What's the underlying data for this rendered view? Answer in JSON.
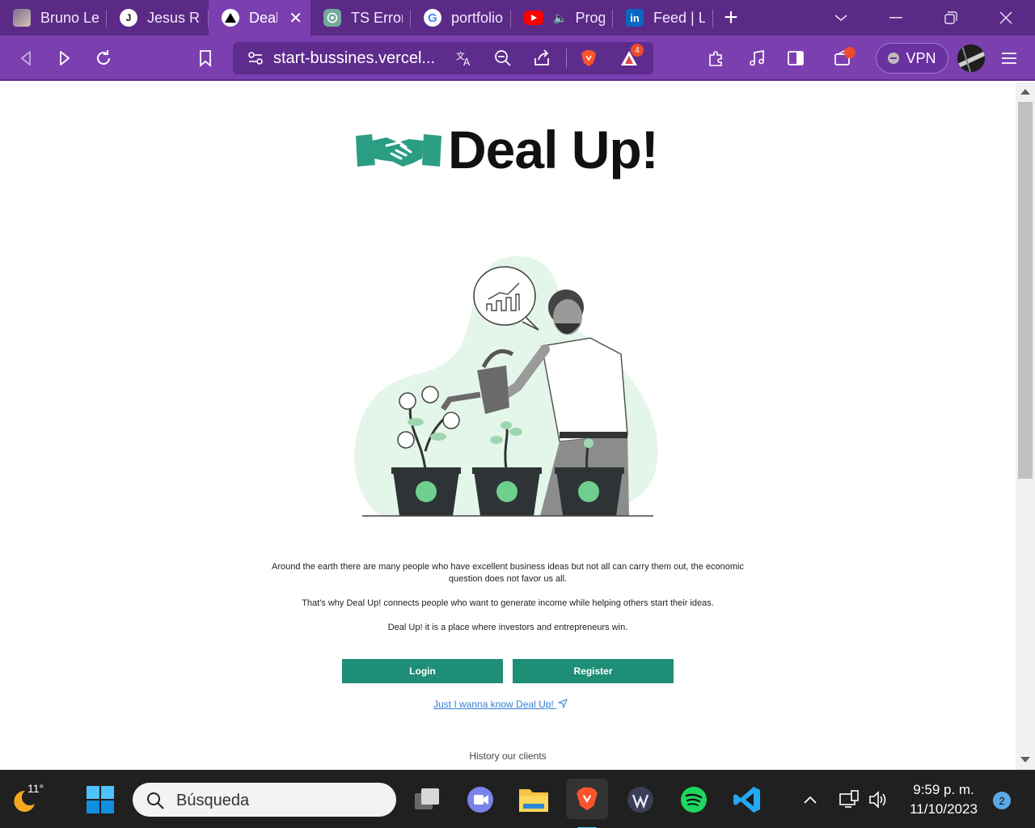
{
  "browser": {
    "tabs": [
      {
        "title": "Bruno Le",
        "favicon": "avatar-photo"
      },
      {
        "title": "Jesus Re",
        "favicon": "j-letter-icon"
      },
      {
        "title": "Deal",
        "favicon": "triangle-icon",
        "active": true
      },
      {
        "title": "TS Error:",
        "favicon": "chatgpt-icon"
      },
      {
        "title": "portfolio",
        "favicon": "google-icon"
      },
      {
        "title": "Progr",
        "favicon": "youtube-icon"
      },
      {
        "title": "Feed | Lin",
        "favicon": "linkedin-icon"
      }
    ],
    "url": "start-bussines.vercel...",
    "shield_badge": "4",
    "vpn_label": "VPN"
  },
  "page": {
    "logo_text": "Deal Up!",
    "intro": [
      "Around the earth there are many people who have excellent business ideas but not all can carry them out, the economic question does not favor us all.",
      "That's why Deal Up! connects people who want to generate income while helping others start their ideas.",
      "Deal Up! it is a place where investors and entrepreneurs win."
    ],
    "login_label": "Login",
    "register_label": "Register",
    "know_link": "Just I wanna know Deal Up!",
    "history_label": "History our clients",
    "accent_color": "#1e8e77"
  },
  "taskbar": {
    "temperature": "11°",
    "search_placeholder": "Búsqueda",
    "time": "9:59 p. m.",
    "date": "11/10/2023",
    "notifications": "2"
  }
}
